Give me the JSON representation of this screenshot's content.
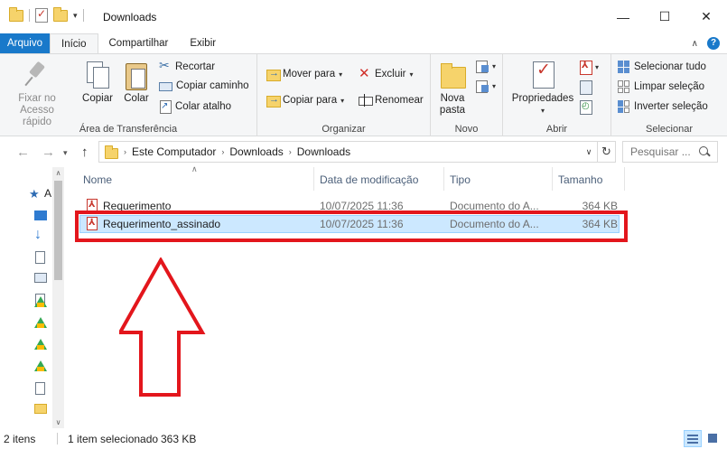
{
  "window": {
    "title": "Downloads",
    "controls": {
      "minimize": "—",
      "maximize": "☐",
      "close": "✕"
    }
  },
  "ribbon_tabs": [
    "Arquivo",
    "Início",
    "Compartilhar",
    "Exibir"
  ],
  "ribbon": {
    "clipboard": {
      "pin_label": "Fixar no Acesso rápido",
      "copy_label": "Copiar",
      "paste_label": "Colar",
      "cut_label": "Recortar",
      "copy_path_label": "Copiar caminho",
      "paste_shortcut_label": "Colar atalho",
      "group_label": "Área de Transferência"
    },
    "organize": {
      "move_to_label": "Mover para",
      "copy_to_label": "Copiar para",
      "delete_label": "Excluir",
      "rename_label": "Renomear",
      "group_label": "Organizar"
    },
    "new": {
      "new_folder_label": "Nova pasta",
      "group_label": "Novo"
    },
    "open": {
      "properties_label": "Propriedades",
      "group_label": "Abrir"
    },
    "select": {
      "select_all_label": "Selecionar tudo",
      "select_none_label": "Limpar seleção",
      "invert_label": "Inverter seleção",
      "group_label": "Selecionar"
    }
  },
  "address_bar": {
    "crumbs": [
      "Este Computador",
      "Downloads",
      "Downloads"
    ]
  },
  "search": {
    "placeholder": "Pesquisar ..."
  },
  "columns": {
    "name": "Nome",
    "date": "Data de modificação",
    "type": "Tipo",
    "size": "Tamanho"
  },
  "files": [
    {
      "name": "Requerimento",
      "date": "10/07/2025 11:36",
      "type": "Documento do A...",
      "size": "364 KB",
      "selected": false
    },
    {
      "name": "Requerimento_assinado",
      "date": "10/07/2025 11:36",
      "type": "Documento do A...",
      "size": "364 KB",
      "selected": true
    }
  ],
  "nav_pane": {
    "quick_access_letter": "A"
  },
  "status": {
    "item_count": "2 itens",
    "selection": "1 item selecionado",
    "selection_size": "363 KB"
  },
  "colors": {
    "accent": "#1979ca",
    "selection_bg": "#cce8ff",
    "annotation_red": "#e3161c"
  }
}
